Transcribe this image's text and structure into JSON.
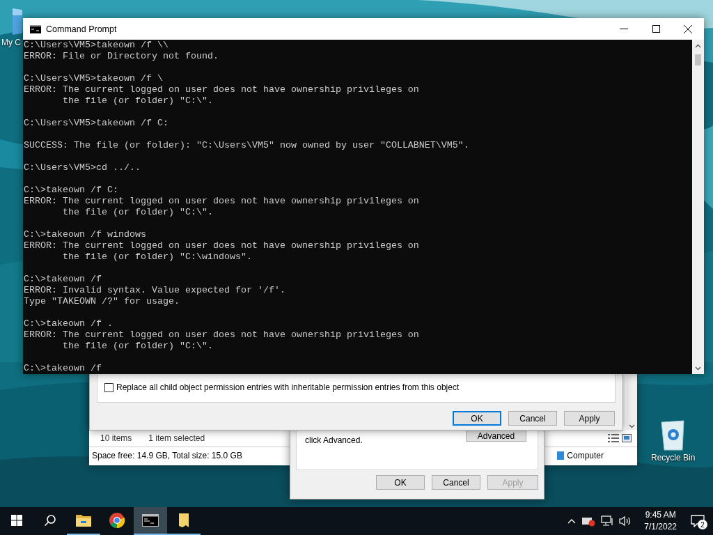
{
  "desktop_icons": [
    {
      "kind": "computer",
      "label": "My C"
    },
    {
      "kind": "recycle",
      "label": "Recycle Bin"
    }
  ],
  "explorer": {
    "item_count": "10 items",
    "selection": "1 item selected",
    "space": "Space free: 14.9 GB, Total size: 15.0 GB",
    "location": "Computer"
  },
  "properties_dialog": {
    "hint": "click Advanced.",
    "advanced_button": "Advanced",
    "buttons": [
      {
        "label": "OK",
        "disabled": false
      },
      {
        "label": "Cancel",
        "disabled": false
      },
      {
        "label": "Apply",
        "disabled": true
      }
    ]
  },
  "advanced_dialog": {
    "checkbox": {
      "label": "Replace all child object permission entries with inheritable permission entries from this object",
      "checked": false
    },
    "buttons": [
      {
        "label": "OK",
        "focused": true
      },
      {
        "label": "Cancel",
        "focused": false
      },
      {
        "label": "Apply",
        "focused": false
      }
    ]
  },
  "command_prompt": {
    "title": "Command Prompt",
    "blocks": [
      [
        "C:\\Users\\VM5>takeown /f \\\\",
        "ERROR: File or Directory not found."
      ],
      [
        "C:\\Users\\VM5>takeown /f \\",
        "ERROR: The current logged on user does not have ownership privileges on",
        "       the file (or folder) \"C:\\\"."
      ],
      [
        "C:\\Users\\VM5>takeown /f C:"
      ],
      [
        "SUCCESS: The file (or folder): \"C:\\Users\\VM5\" now owned by user \"COLLABNET\\VM5\"."
      ],
      [
        "C:\\Users\\VM5>cd ../.."
      ],
      [
        "C:\\>takeown /f C:",
        "ERROR: The current logged on user does not have ownership privileges on",
        "       the file (or folder) \"C:\\\"."
      ],
      [
        "C:\\>takeown /f windows",
        "ERROR: The current logged on user does not have ownership privileges on",
        "       the file (or folder) \"C:\\windows\"."
      ],
      [
        "C:\\>takeown /f",
        "ERROR: Invalid syntax. Value expected for '/f'.",
        "Type \"TAKEOWN /?\" for usage."
      ],
      [
        "C:\\>takeown /f .",
        "ERROR: The current logged on user does not have ownership privileges on",
        "       the file (or folder) \"C:\\\"."
      ],
      [
        "C:\\>takeown /f"
      ]
    ]
  },
  "taskbar": {
    "items": [
      {
        "kind": "start",
        "running": false,
        "active": false
      },
      {
        "kind": "search",
        "running": false,
        "active": false
      },
      {
        "kind": "explorer",
        "running": true,
        "active": false
      },
      {
        "kind": "chrome",
        "running": false,
        "active": false
      },
      {
        "kind": "console",
        "running": true,
        "active": true
      },
      {
        "kind": "folder",
        "running": true,
        "active": false
      }
    ],
    "clock": {
      "time": "9:45 AM",
      "date": "7/1/2022"
    },
    "notifications": "2"
  }
}
